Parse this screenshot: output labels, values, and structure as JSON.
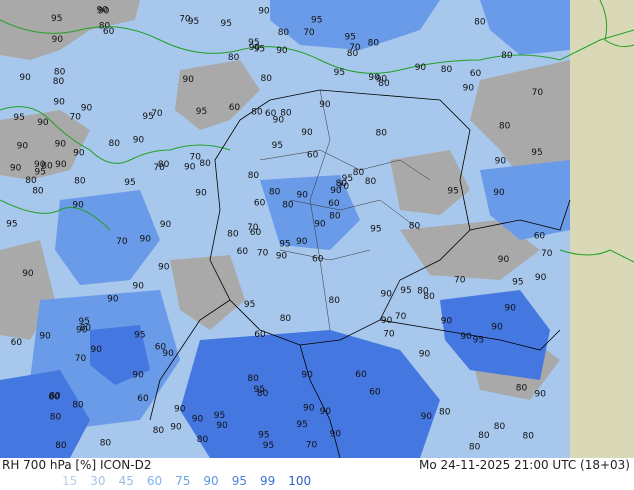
{
  "footer": {
    "title": "RH 700 hPa [%] ICON-D2",
    "timestamp": "Mo 24-11-2025 21:00 UTC (18+03)"
  },
  "legend": {
    "levels": [
      {
        "label": "15",
        "color": "#b8cfe8"
      },
      {
        "label": "30",
        "color": "#a9c3e3"
      },
      {
        "label": "45",
        "color": "#9bb8de"
      },
      {
        "label": "60",
        "color": "#80b4f0"
      },
      {
        "label": "75",
        "color": "#6fa5ea"
      },
      {
        "label": "90",
        "color": "#5e95e4"
      },
      {
        "label": "95",
        "color": "#4d83dc"
      },
      {
        "label": "99",
        "color": "#3c70d2"
      },
      {
        "label": "100",
        "color": "#2d5fc8"
      }
    ]
  },
  "map": {
    "colors": {
      "low": "#a9a9a9",
      "mid": "#a7c8ec",
      "high": "#6a9be8",
      "very_high": "#4577e0",
      "outside": "#d9d9b8",
      "border": "#000000",
      "coast": "#23a023"
    },
    "contour_labels": [
      "90",
      "70",
      "60",
      "80",
      "90",
      "90",
      "80",
      "80",
      "90",
      "90",
      "60",
      "80",
      "90",
      "70",
      "60",
      "80",
      "80",
      "80",
      "60",
      "90",
      "80",
      "80",
      "60",
      "60",
      "70",
      "80",
      "90",
      "95",
      "80",
      "90",
      "95",
      "70",
      "80",
      "60",
      "70",
      "90",
      "60",
      "80",
      "80",
      "80",
      "95",
      "90",
      "95",
      "70",
      "80",
      "90",
      "60",
      "80",
      "80",
      "80",
      "70",
      "80",
      "90",
      "70",
      "60",
      "90",
      "80",
      "95",
      "90",
      "60",
      "80",
      "90",
      "80",
      "90",
      "80",
      "90",
      "70",
      "80",
      "80",
      "60",
      "60",
      "90",
      "95",
      "70",
      "60",
      "90",
      "80",
      "90",
      "80",
      "90",
      "90",
      "80",
      "95",
      "90",
      "95",
      "90",
      "80",
      "80",
      "70",
      "60",
      "95",
      "70",
      "80",
      "90",
      "80",
      "90",
      "95",
      "95",
      "90",
      "80",
      "70",
      "70",
      "60",
      "80",
      "90",
      "95",
      "90",
      "80",
      "90",
      "90",
      "90",
      "80",
      "90",
      "80",
      "95",
      "90",
      "70",
      "80",
      "60",
      "95",
      "90",
      "80",
      "90",
      "95",
      "80",
      "90",
      "80",
      "90",
      "95",
      "90",
      "80",
      "90",
      "80",
      "90",
      "95",
      "90",
      "90",
      "95",
      "90",
      "70",
      "60",
      "80",
      "90",
      "90",
      "95",
      "80",
      "95",
      "90",
      "95",
      "90",
      "90",
      "95",
      "90",
      "80",
      "70",
      "70",
      "80",
      "95",
      "90",
      "90",
      "80",
      "90",
      "95",
      "90",
      "80",
      "90",
      "95",
      "90",
      "90",
      "80",
      "95",
      "90",
      "90",
      "95",
      "80",
      "90",
      "95",
      "90",
      "95",
      "90",
      "90",
      "95",
      "95",
      "90"
    ]
  }
}
